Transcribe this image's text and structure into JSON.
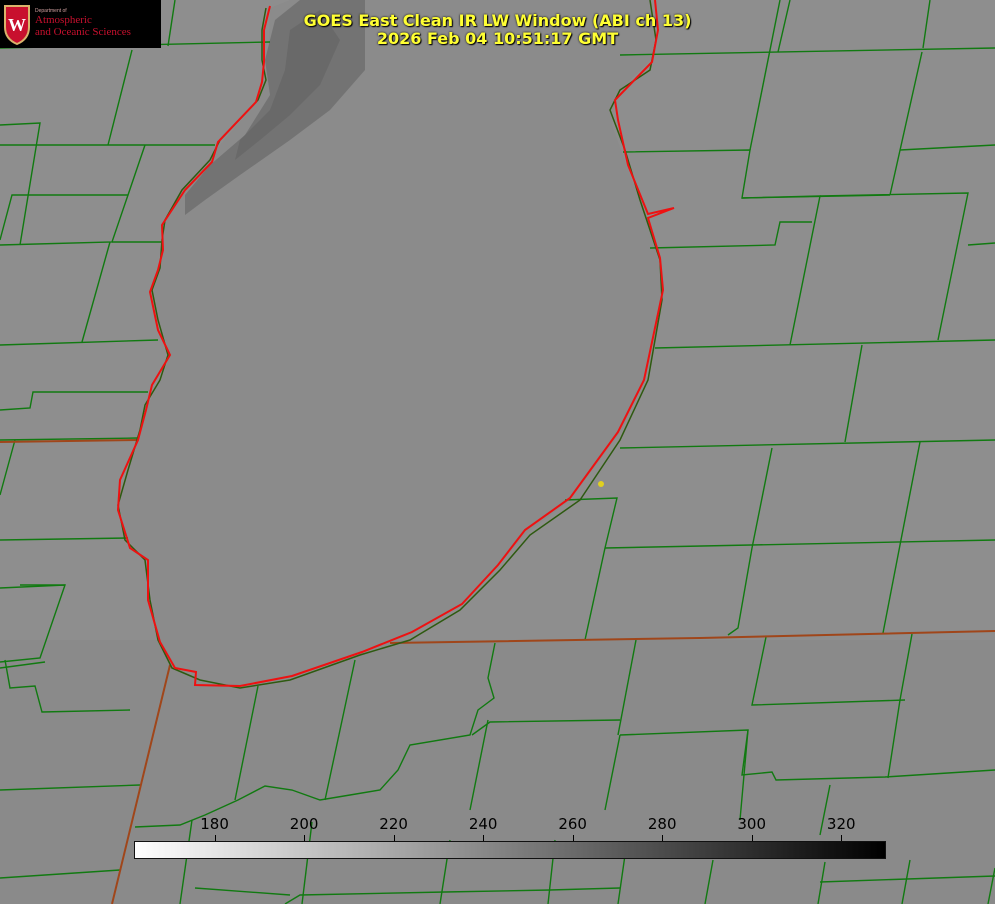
{
  "title": {
    "line1": "GOES East Clean IR LW Window (ABI ch 13)",
    "line2": "2026 Feb 04 10:51:17 GMT"
  },
  "logo": {
    "dept": "Department of",
    "line1": "Atmospheric",
    "line2": "and Oceanic Sciences",
    "crest_letter": "W",
    "crest_color": "#c8102e"
  },
  "colorbar": {
    "min": 162,
    "max": 330,
    "ticks": [
      "180",
      "200",
      "220",
      "240",
      "260",
      "280",
      "300",
      "320"
    ],
    "gradient": [
      "#ffffff",
      "#000000"
    ]
  },
  "colors": {
    "background": "#8e8e8e",
    "county_lines": "#117a11",
    "state_lines": "#a0461a",
    "coastline": "#ee1111",
    "title_text": "#ffff33",
    "marker": "#e0d020"
  }
}
